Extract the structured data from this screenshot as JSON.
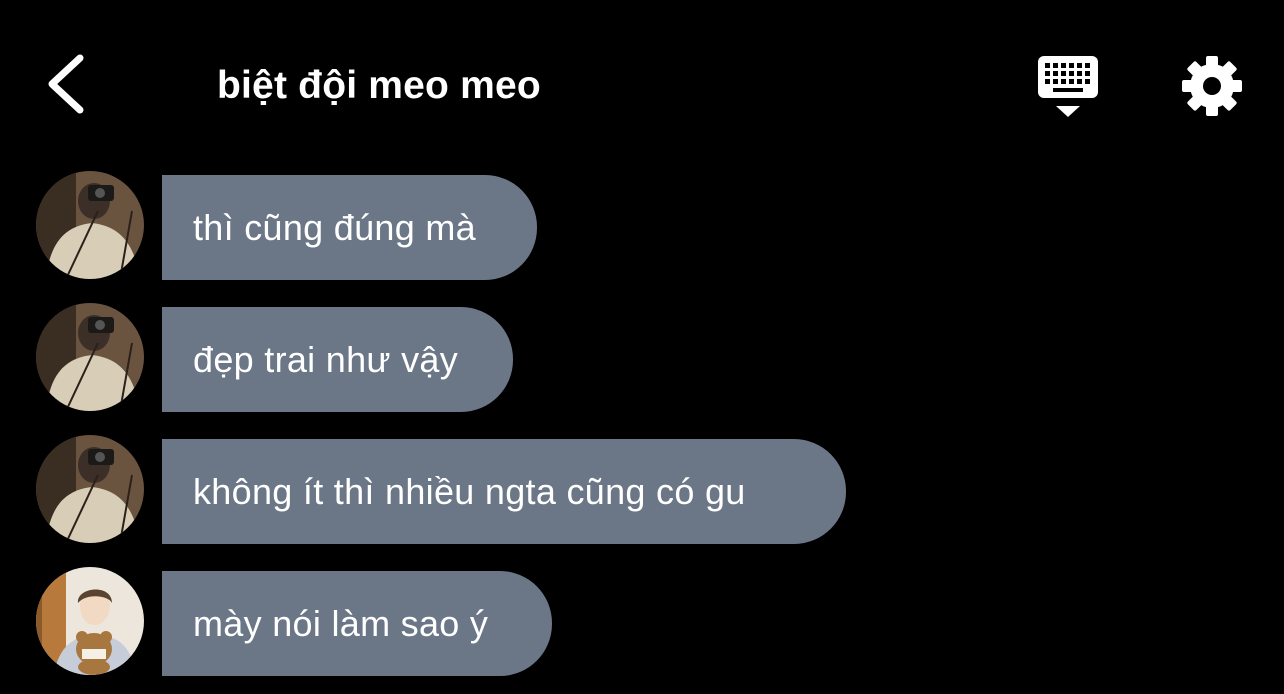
{
  "header": {
    "title": "biệt đội meo meo",
    "back_icon": "chevron-left-icon",
    "keyboard_icon": "keyboard-hide-icon",
    "settings_icon": "gear-icon"
  },
  "messages": [
    {
      "text": "thì cũng đúng mà",
      "avatar": "avatar-selfie-camera"
    },
    {
      "text": "đẹp trai như vậy",
      "avatar": "avatar-selfie-camera"
    },
    {
      "text": "không ít thì nhiều ngta cũng có gu",
      "avatar": "avatar-selfie-camera"
    },
    {
      "text": "mày nói làm sao ý",
      "avatar": "avatar-teddy-bear"
    }
  ],
  "colors": {
    "background": "#000000",
    "bubble": "#6b7787",
    "text": "#ffffff"
  }
}
